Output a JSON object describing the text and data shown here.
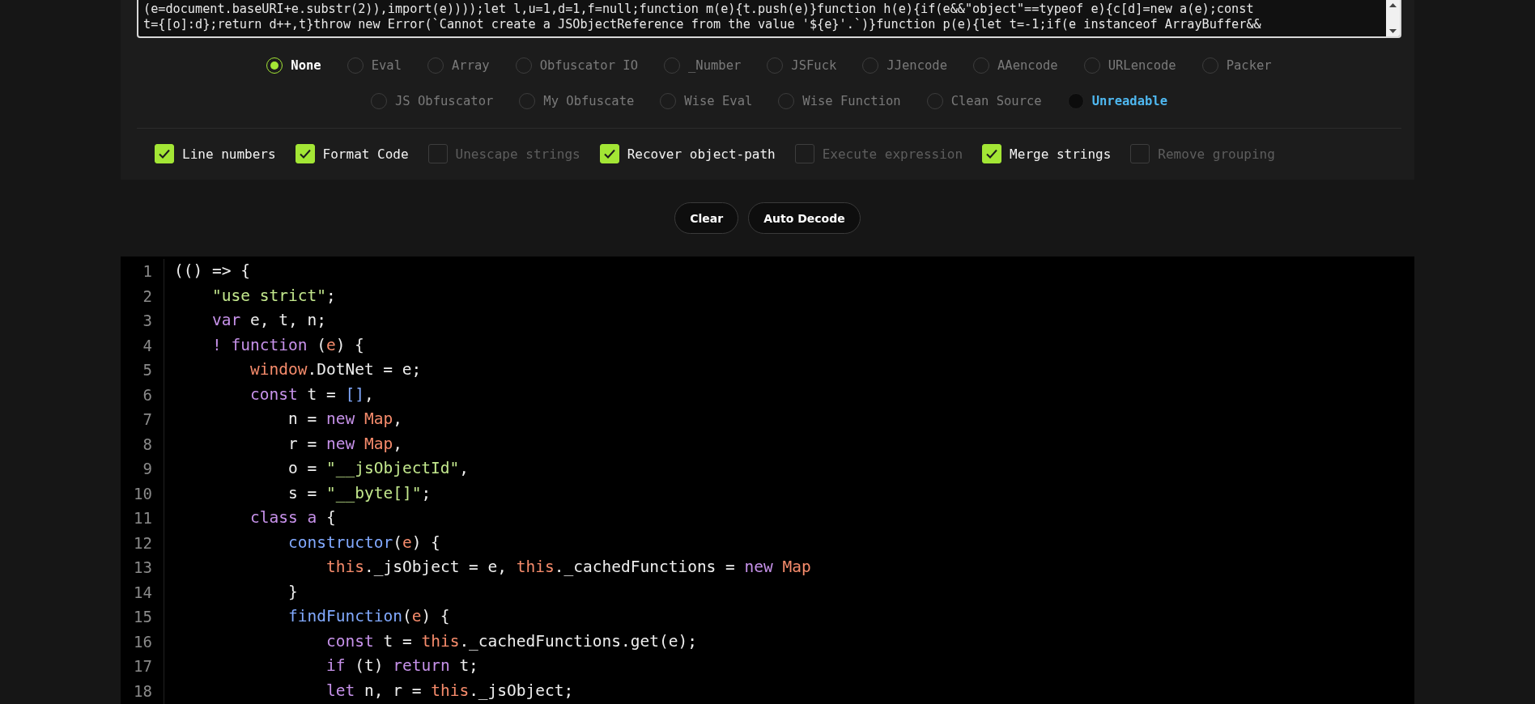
{
  "source_lines": [
    "(e=document.baseURI+e.substr(2)),import(e))));let l,u=1,d=1,f=null;function m(e){t.push(e)}function h(e){if(e&&\"object\"==typeof e){c[d]=new a(e);const",
    "t={[o]:d};return d++,t}throw new Error(`Cannot create a JSObjectReference from the value '${e}'.`)}function p(e){let t=-1;if(e instanceof ArrayBuffer&&"
  ],
  "decoder_rows": [
    [
      {
        "label": "None",
        "selected": true,
        "highlighted": false
      },
      {
        "label": "Eval",
        "selected": false,
        "highlighted": false
      },
      {
        "label": "Array",
        "selected": false,
        "highlighted": false
      },
      {
        "label": "Obfuscator IO",
        "selected": false,
        "highlighted": false
      },
      {
        "label": "_Number",
        "selected": false,
        "highlighted": false
      },
      {
        "label": "JSFuck",
        "selected": false,
        "highlighted": false
      },
      {
        "label": "JJencode",
        "selected": false,
        "highlighted": false
      },
      {
        "label": "AAencode",
        "selected": false,
        "highlighted": false
      },
      {
        "label": "URLencode",
        "selected": false,
        "highlighted": false
      },
      {
        "label": "Packer",
        "selected": false,
        "highlighted": false
      }
    ],
    [
      {
        "label": "JS Obfuscator",
        "selected": false,
        "highlighted": false
      },
      {
        "label": "My Obfuscate",
        "selected": false,
        "highlighted": false
      },
      {
        "label": "Wise Eval",
        "selected": false,
        "highlighted": false
      },
      {
        "label": "Wise Function",
        "selected": false,
        "highlighted": false
      },
      {
        "label": "Clean Source",
        "selected": false,
        "highlighted": false
      },
      {
        "label": "Unreadable",
        "selected": false,
        "highlighted": true
      }
    ]
  ],
  "options": [
    {
      "label": "Line numbers",
      "checked": true
    },
    {
      "label": "Format Code",
      "checked": true
    },
    {
      "label": "Unescape strings",
      "checked": false
    },
    {
      "label": "Recover object-path",
      "checked": true
    },
    {
      "label": "Execute expression",
      "checked": false
    },
    {
      "label": "Merge strings",
      "checked": true
    },
    {
      "label": "Remove grouping",
      "checked": false
    }
  ],
  "buttons": [
    "Clear",
    "Auto Decode"
  ],
  "output": [
    {
      "number": "1",
      "tokens": [
        {
          "kind": "plain",
          "text": "(() => {"
        }
      ],
      "children": [
        {
          "number": "2",
          "tokens": [
            {
              "kind": "string",
              "text": "\"use strict\""
            },
            {
              "kind": "plain",
              "text": ";"
            }
          ]
        },
        {
          "number": "3",
          "tokens": [
            {
              "kind": "keyword",
              "text": "var"
            },
            {
              "kind": "plain",
              "text": " e, t, n;"
            }
          ]
        },
        {
          "number": "4",
          "tokens": [
            {
              "kind": "keyword",
              "text": "! function"
            },
            {
              "kind": "plain",
              "text": " ("
            },
            {
              "kind": "variable",
              "text": "e"
            },
            {
              "kind": "plain",
              "text": ") {"
            }
          ],
          "children": [
            {
              "number": "5",
              "tokens": [
                {
                  "kind": "variable",
                  "text": "window"
                },
                {
                  "kind": "plain",
                  "text": ".DotNet = e;"
                }
              ]
            },
            {
              "number": "6",
              "tokens": [
                {
                  "kind": "keyword",
                  "text": "const"
                },
                {
                  "kind": "plain",
                  "text": " t = "
                },
                {
                  "kind": "function",
                  "text": "[]"
                },
                {
                  "kind": "plain",
                  "text": ","
                }
              ],
              "children": [
                {
                  "number": "7",
                  "tokens": [
                    {
                      "kind": "plain",
                      "text": "n = "
                    },
                    {
                      "kind": "keyword",
                      "text": "new"
                    },
                    {
                      "kind": "variable",
                      "text": " Map"
                    },
                    {
                      "kind": "plain",
                      "text": ","
                    }
                  ]
                },
                {
                  "number": "8",
                  "tokens": [
                    {
                      "kind": "plain",
                      "text": "r = "
                    },
                    {
                      "kind": "keyword",
                      "text": "new"
                    },
                    {
                      "kind": "variable",
                      "text": " Map"
                    },
                    {
                      "kind": "plain",
                      "text": ","
                    }
                  ]
                },
                {
                  "number": "9",
                  "tokens": [
                    {
                      "kind": "plain",
                      "text": "o = "
                    },
                    {
                      "kind": "string",
                      "text": "\"__jsObjectId\""
                    },
                    {
                      "kind": "plain",
                      "text": ","
                    }
                  ]
                },
                {
                  "number": "10",
                  "tokens": [
                    {
                      "kind": "plain",
                      "text": "s = "
                    },
                    {
                      "kind": "string",
                      "text": "\"__byte[]\""
                    },
                    {
                      "kind": "plain",
                      "text": ";"
                    }
                  ]
                }
              ]
            },
            {
              "number": "11",
              "tokens": [
                {
                  "kind": "keyword",
                  "text": "class a"
                },
                {
                  "kind": "plain",
                  "text": " {"
                }
              ],
              "children": [
                {
                  "number": "12",
                  "tokens": [
                    {
                      "kind": "function",
                      "text": "constructor"
                    },
                    {
                      "kind": "plain",
                      "text": "("
                    },
                    {
                      "kind": "variable",
                      "text": "e"
                    },
                    {
                      "kind": "plain",
                      "text": ") {"
                    }
                  ],
                  "children": [
                    {
                      "number": "13",
                      "tokens": [
                        {
                          "kind": "variable",
                          "text": "this"
                        },
                        {
                          "kind": "plain",
                          "text": "._jsObject = e, "
                        },
                        {
                          "kind": "variable",
                          "text": "this"
                        },
                        {
                          "kind": "plain",
                          "text": "._cachedFunctions = "
                        },
                        {
                          "kind": "keyword",
                          "text": "new"
                        },
                        {
                          "kind": "variable",
                          "text": " Map"
                        }
                      ]
                    }
                  ]
                },
                {
                  "number": "14",
                  "tokens": [
                    {
                      "kind": "plain",
                      "text": "}"
                    }
                  ]
                },
                {
                  "number": "15",
                  "tokens": [
                    {
                      "kind": "function",
                      "text": "findFunction"
                    },
                    {
                      "kind": "plain",
                      "text": "("
                    },
                    {
                      "kind": "variable",
                      "text": "e"
                    },
                    {
                      "kind": "plain",
                      "text": ") {"
                    }
                  ],
                  "children": [
                    {
                      "number": "16",
                      "tokens": [
                        {
                          "kind": "keyword",
                          "text": "const"
                        },
                        {
                          "kind": "plain",
                          "text": " t = "
                        },
                        {
                          "kind": "variable",
                          "text": "this"
                        },
                        {
                          "kind": "plain",
                          "text": "._cachedFunctions.get(e);"
                        }
                      ]
                    },
                    {
                      "number": "17",
                      "tokens": [
                        {
                          "kind": "keyword",
                          "text": "if"
                        },
                        {
                          "kind": "plain",
                          "text": " (t) "
                        },
                        {
                          "kind": "keyword",
                          "text": "return"
                        },
                        {
                          "kind": "plain",
                          "text": " t;"
                        }
                      ]
                    },
                    {
                      "number": "18",
                      "tokens": [
                        {
                          "kind": "keyword",
                          "text": "let"
                        },
                        {
                          "kind": "plain",
                          "text": " n, r = "
                        },
                        {
                          "kind": "variable",
                          "text": "this"
                        },
                        {
                          "kind": "plain",
                          "text": "._jsObject;"
                        }
                      ]
                    }
                  ]
                }
              ]
            }
          ]
        }
      ]
    }
  ]
}
